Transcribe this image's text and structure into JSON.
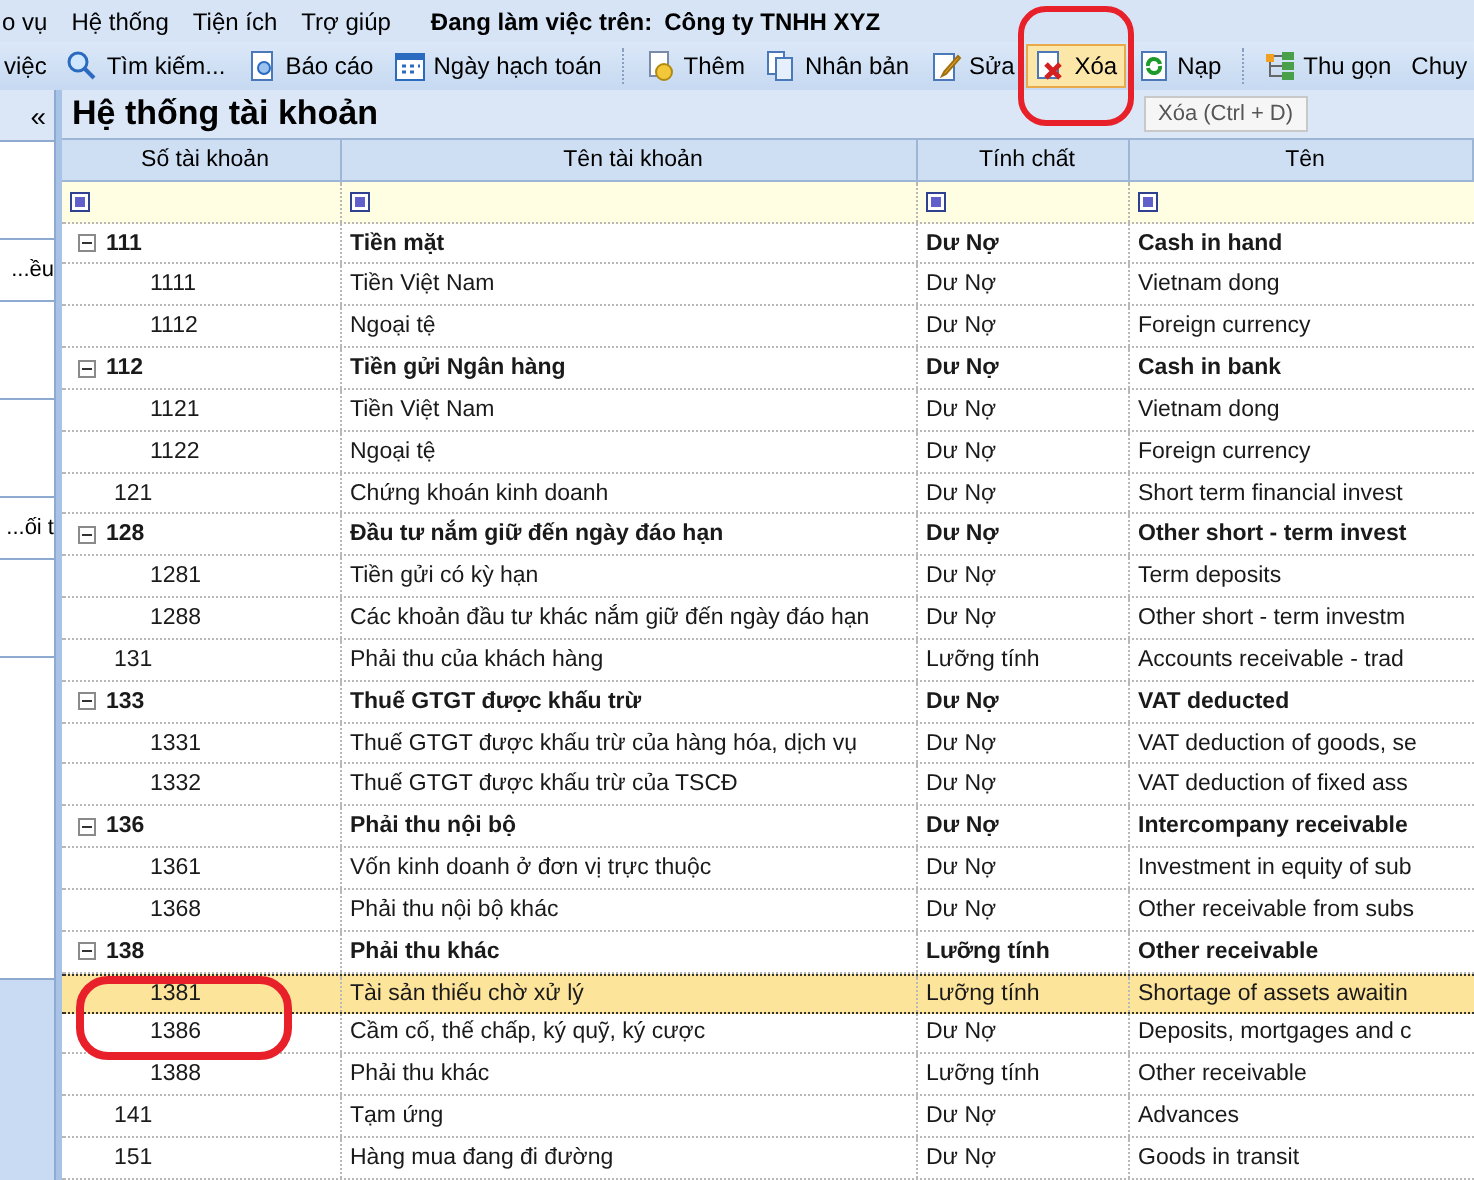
{
  "menu": {
    "items": [
      "o vụ",
      "Hệ thống",
      "Tiện ích",
      "Trợ giúp"
    ],
    "workspace_label": "Đang làm việc trên:",
    "company": "Công ty TNHH XYZ"
  },
  "toolbar": {
    "items": [
      {
        "kind": "text",
        "label": "việc",
        "highlighted": false
      },
      {
        "kind": "search",
        "label": "Tìm kiếm...",
        "highlighted": false
      },
      {
        "kind": "report",
        "label": "Báo cáo",
        "highlighted": false
      },
      {
        "kind": "calendar",
        "label": "Ngày hạch toán",
        "highlighted": false
      },
      {
        "kind": "separator"
      },
      {
        "kind": "add",
        "label": "Thêm",
        "highlighted": false
      },
      {
        "kind": "copy",
        "label": "Nhân bản",
        "highlighted": false
      },
      {
        "kind": "edit",
        "label": "Sửa",
        "highlighted": false
      },
      {
        "kind": "delete",
        "label": "Xóa",
        "highlighted": true
      },
      {
        "kind": "reload",
        "label": "Nạp",
        "highlighted": false
      },
      {
        "kind": "separator"
      },
      {
        "kind": "collapse",
        "label": "Thu gọn",
        "highlighted": false
      },
      {
        "kind": "text",
        "label": "Chuy",
        "highlighted": false
      }
    ]
  },
  "tooltip": "Xóa (Ctrl + D)",
  "sidebar": {
    "collapse_glyph": "«",
    "items": [
      "ều...",
      "ối t..."
    ]
  },
  "grid": {
    "title": "Hệ thống tài khoản",
    "columns": [
      "Số tài khoản",
      "Tên tài khoản",
      "Tính chất",
      "Tên"
    ],
    "rows": [
      {
        "kind": "group",
        "expanded": true,
        "selected": false,
        "code": "111",
        "name": "Tiền mặt",
        "nature": "Dư Nợ",
        "english": "Cash in hand"
      },
      {
        "kind": "child",
        "selected": false,
        "code": "1111",
        "name": "Tiền Việt Nam",
        "nature": "Dư Nợ",
        "english": "Vietnam dong"
      },
      {
        "kind": "child",
        "selected": false,
        "code": "1112",
        "name": "Ngoại tệ",
        "nature": "Dư Nợ",
        "english": "Foreign currency"
      },
      {
        "kind": "group",
        "expanded": true,
        "selected": false,
        "code": "112",
        "name": "Tiền gửi Ngân hàng",
        "nature": "Dư Nợ",
        "english": "Cash in bank"
      },
      {
        "kind": "child",
        "selected": false,
        "code": "1121",
        "name": "Tiền Việt Nam",
        "nature": "Dư Nợ",
        "english": "Vietnam dong"
      },
      {
        "kind": "child",
        "selected": false,
        "code": "1122",
        "name": "Ngoại tệ",
        "nature": "Dư Nợ",
        "english": "Foreign currency"
      },
      {
        "kind": "leaf",
        "selected": false,
        "code": "121",
        "name": "Chứng khoán kinh doanh",
        "nature": "Dư Nợ",
        "english": "Short term financial invest"
      },
      {
        "kind": "group",
        "expanded": true,
        "selected": false,
        "code": "128",
        "name": "Đầu tư nắm giữ đến ngày đáo hạn",
        "nature": "Dư Nợ",
        "english": "Other short - term invest"
      },
      {
        "kind": "child",
        "selected": false,
        "code": "1281",
        "name": "Tiền gửi có kỳ hạn",
        "nature": "Dư Nợ",
        "english": "Term deposits"
      },
      {
        "kind": "child",
        "selected": false,
        "code": "1288",
        "name": "Các khoản đầu tư khác nắm giữ đến ngày đáo hạn",
        "nature": "Dư Nợ",
        "english": "Other short - term investm"
      },
      {
        "kind": "leaf",
        "selected": false,
        "code": "131",
        "name": "Phải thu của khách hàng",
        "nature": "Lưỡng tính",
        "english": "Accounts receivable - trad"
      },
      {
        "kind": "group",
        "expanded": true,
        "selected": false,
        "code": "133",
        "name": "Thuế GTGT được khấu trừ",
        "nature": "Dư Nợ",
        "english": "VAT deducted"
      },
      {
        "kind": "child",
        "selected": false,
        "code": "1331",
        "name": "Thuế GTGT được khấu trừ của hàng hóa, dịch vụ",
        "nature": "Dư Nợ",
        "english": "VAT deduction of goods, se"
      },
      {
        "kind": "child",
        "selected": false,
        "code": "1332",
        "name": "Thuế GTGT được khấu trừ của TSCĐ",
        "nature": "Dư Nợ",
        "english": "VAT deduction of fixed ass"
      },
      {
        "kind": "group",
        "expanded": true,
        "selected": false,
        "code": "136",
        "name": "Phải thu nội bộ",
        "nature": "Dư Nợ",
        "english": "Intercompany receivable"
      },
      {
        "kind": "child",
        "selected": false,
        "code": "1361",
        "name": "Vốn kinh doanh ở đơn vị trực thuộc",
        "nature": "Dư Nợ",
        "english": "Investment in equity of sub"
      },
      {
        "kind": "child",
        "selected": false,
        "code": "1368",
        "name": "Phải thu nội bộ khác",
        "nature": "Dư Nợ",
        "english": "Other receivable from subs"
      },
      {
        "kind": "group",
        "expanded": true,
        "selected": false,
        "code": "138",
        "name": "Phải thu khác",
        "nature": "Lưỡng tính",
        "english": "Other receivable"
      },
      {
        "kind": "child",
        "selected": true,
        "code": "1381",
        "name": "Tài sản thiếu chờ xử lý",
        "nature": "Lưỡng tính",
        "english": "Shortage of assets awaitin"
      },
      {
        "kind": "child",
        "selected": false,
        "code": "1386",
        "name": "Cầm cố, thế chấp, ký quỹ, ký cược",
        "nature": "Dư Nợ",
        "english": "Deposits, mortgages and c"
      },
      {
        "kind": "child",
        "selected": false,
        "code": "1388",
        "name": "Phải thu khác",
        "nature": "Lưỡng tính",
        "english": "Other receivable"
      },
      {
        "kind": "leaf",
        "selected": false,
        "code": "141",
        "name": "Tạm ứng",
        "nature": "Dư Nợ",
        "english": "Advances"
      },
      {
        "kind": "leaf",
        "selected": false,
        "code": "151",
        "name": "Hàng mua đang đi đường",
        "nature": "Dư Nợ",
        "english": "Goods in transit"
      }
    ]
  }
}
